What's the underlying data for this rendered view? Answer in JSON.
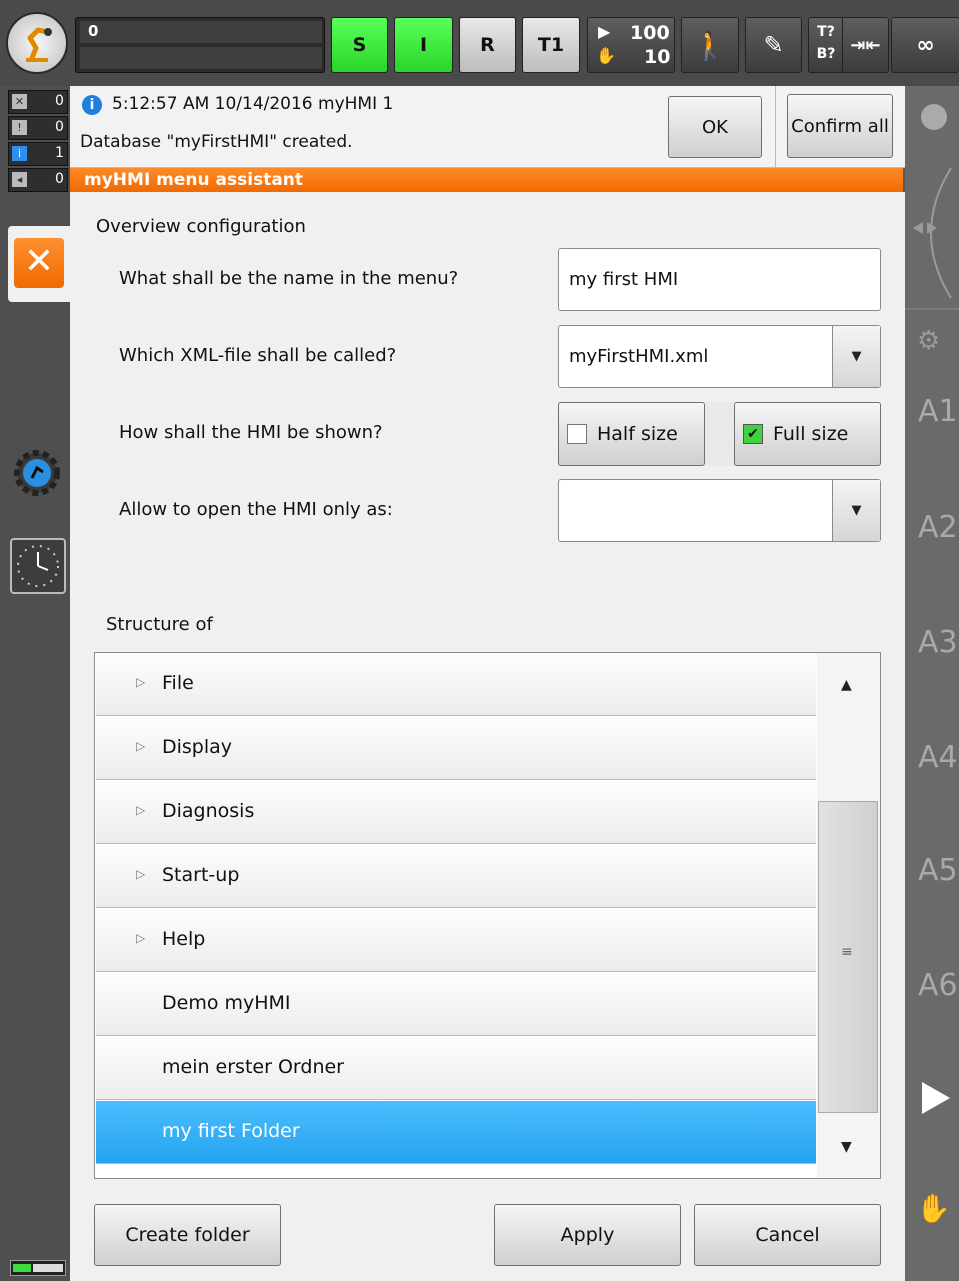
{
  "topbar": {
    "status_value": "0",
    "btn_s": "S",
    "btn_i": "I",
    "btn_r": "R",
    "btn_t1": "T1",
    "override_prog": "100",
    "override_jog": "10",
    "tb_t": "T?",
    "tb_b": "B?",
    "infinity": "∞"
  },
  "counters": [
    {
      "value": "0"
    },
    {
      "value": "0"
    },
    {
      "value": "1"
    },
    {
      "value": "0"
    }
  ],
  "message": {
    "timestamp": "5:12:57 AM 10/14/2016 myHMI 1",
    "text": "Database \"myFirstHMI\" created.",
    "ok_label": "OK",
    "confirm_all_label": "Confirm all"
  },
  "title": "myHMI menu assistant",
  "overview": {
    "heading": "Overview configuration",
    "name_question": "What shall be the name in the menu?",
    "name_value": "my first HMI",
    "xml_question": "Which XML-file shall be called?",
    "xml_value": "myFirstHMI.xml",
    "show_question": "How shall the HMI be shown?",
    "half_size_label": "Half size",
    "half_size_checked": false,
    "full_size_label": "Full size",
    "full_size_checked": true,
    "allow_question": "Allow to open the HMI only as:",
    "allow_value": ""
  },
  "structure": {
    "heading": "Structure of",
    "items": [
      {
        "label": "File",
        "expandable": true,
        "selected": false
      },
      {
        "label": "Display",
        "expandable": true,
        "selected": false
      },
      {
        "label": "Diagnosis",
        "expandable": true,
        "selected": false
      },
      {
        "label": "Start-up",
        "expandable": true,
        "selected": false
      },
      {
        "label": "Help",
        "expandable": true,
        "selected": false
      },
      {
        "label": "Demo myHMI",
        "expandable": false,
        "selected": false
      },
      {
        "label": "mein erster Ordner",
        "expandable": false,
        "selected": false
      },
      {
        "label": "my first Folder",
        "expandable": false,
        "selected": true
      }
    ]
  },
  "buttons": {
    "create_folder": "Create folder",
    "apply": "Apply",
    "cancel": "Cancel"
  },
  "axes": [
    "A1",
    "A2",
    "A3",
    "A4",
    "A5",
    "A6"
  ],
  "colors": {
    "accent_orange": "#f26a00",
    "selection_blue": "#23a4ef",
    "status_green": "#29d529"
  }
}
